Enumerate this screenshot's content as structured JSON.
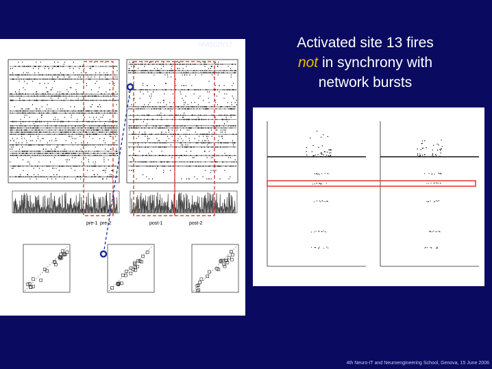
{
  "slide": {
    "title_line1": "Activated site 13 fires",
    "title_not": "not",
    "title_line2_rest": " in synchrony with",
    "title_line3": "network bursts",
    "footer": "4th Neuro-IT and Neuroengineering School, Genova, 15 June 2006",
    "colors": {
      "background": "#0a0a60",
      "title": "#ffffff",
      "emphasis": "#e8c000",
      "highlight_box": "#e03030",
      "dashed_box": "#cc2222",
      "marker": "#1a2aa0"
    }
  },
  "left_figure": {
    "dataset_label": "nh4502lr17",
    "interval_labels": [
      "pre-1",
      "pre-2",
      "post-1",
      "post-2"
    ]
  }
}
